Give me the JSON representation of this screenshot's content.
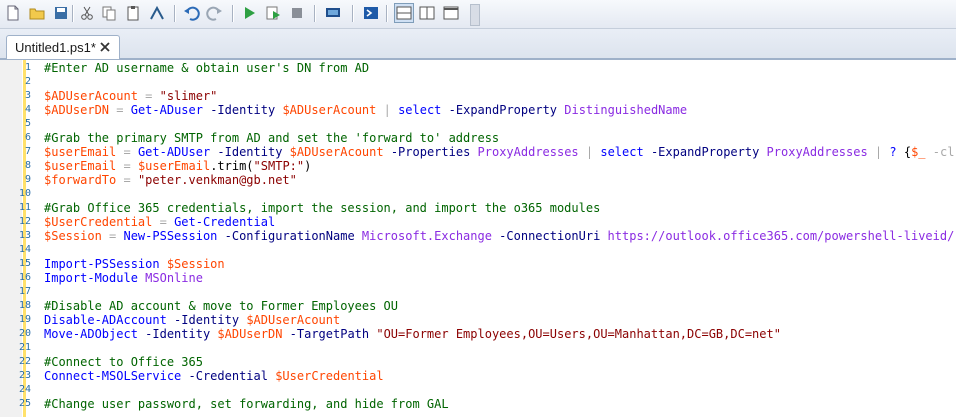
{
  "toolbar": {
    "buttons": [
      {
        "name": "new-file-icon"
      },
      {
        "name": "open-folder-icon"
      },
      {
        "name": "save-icon"
      },
      {
        "name": "cut-icon"
      },
      {
        "name": "copy-icon"
      },
      {
        "name": "paste-icon"
      },
      {
        "name": "clear-console-icon"
      },
      {
        "name": "undo-icon"
      },
      {
        "name": "redo-icon"
      },
      {
        "name": "run-script-icon"
      },
      {
        "name": "run-selection-icon"
      },
      {
        "name": "stop-icon"
      },
      {
        "name": "remote-powershell-icon"
      },
      {
        "name": "powershell-console-icon"
      },
      {
        "name": "layout-top-icon"
      },
      {
        "name": "layout-right-icon"
      },
      {
        "name": "layout-maximize-icon"
      }
    ]
  },
  "tab": {
    "label": "Untitled1.ps1*"
  },
  "editor": {
    "lines": [
      {
        "n": "1",
        "tokens": [
          [
            "c-com",
            "#Enter AD username & obtain user's DN from AD"
          ]
        ]
      },
      {
        "n": "2",
        "tokens": []
      },
      {
        "n": "3",
        "tokens": [
          [
            "c-var",
            "$ADUserAcount"
          ],
          [
            "c-op",
            " = "
          ],
          [
            "c-str",
            "\"slimer\""
          ]
        ]
      },
      {
        "n": "4",
        "tokens": [
          [
            "c-var",
            "$ADUserDN"
          ],
          [
            "c-op",
            " = "
          ],
          [
            "c-cmd",
            "Get-ADuser"
          ],
          [
            "c-par",
            " -Identity "
          ],
          [
            "c-var",
            "$ADUserAcount"
          ],
          [
            "c-op",
            " | "
          ],
          [
            "c-cmd",
            "select"
          ],
          [
            "c-par",
            " -ExpandProperty "
          ],
          [
            "c-arg",
            "DistinguishedName"
          ]
        ]
      },
      {
        "n": "5",
        "tokens": []
      },
      {
        "n": "6",
        "tokens": [
          [
            "c-com",
            "#Grab the primary SMTP from AD and set the 'forward to' address"
          ]
        ]
      },
      {
        "n": "7",
        "tokens": [
          [
            "c-var",
            "$userEmail"
          ],
          [
            "c-op",
            " = "
          ],
          [
            "c-cmd",
            "Get-ADUser"
          ],
          [
            "c-par",
            " -Identity "
          ],
          [
            "c-var",
            "$ADUserAcount"
          ],
          [
            "c-par",
            " -Properties "
          ],
          [
            "c-arg",
            "ProxyAddresses"
          ],
          [
            "c-op",
            " | "
          ],
          [
            "c-cmd",
            "select"
          ],
          [
            "c-par",
            " -ExpandProperty "
          ],
          [
            "c-arg",
            "ProxyAddresses"
          ],
          [
            "c-op",
            " | "
          ],
          [
            "c-cmd",
            "?"
          ],
          [
            "c-mem",
            " {"
          ],
          [
            "c-var",
            "$_"
          ],
          [
            "c-op",
            " -cl"
          ]
        ]
      },
      {
        "n": "8",
        "tokens": [
          [
            "c-var",
            "$userEmail"
          ],
          [
            "c-op",
            " = "
          ],
          [
            "c-var",
            "$userEmail"
          ],
          [
            "c-mem",
            ".trim("
          ],
          [
            "c-str",
            "\"SMTP:\""
          ],
          [
            "c-mem",
            ")"
          ]
        ]
      },
      {
        "n": "9",
        "tokens": [
          [
            "c-var",
            "$forwardTo"
          ],
          [
            "c-op",
            " = "
          ],
          [
            "c-str",
            "\"peter.venkman@gb.net\""
          ]
        ]
      },
      {
        "n": "10",
        "tokens": []
      },
      {
        "n": "11",
        "tokens": [
          [
            "c-com",
            "#Grab Office 365 credentials, import the session, and import the o365 modules"
          ]
        ]
      },
      {
        "n": "12",
        "tokens": [
          [
            "c-var",
            "$UserCredential"
          ],
          [
            "c-op",
            " = "
          ],
          [
            "c-cmd",
            "Get-Credential"
          ]
        ]
      },
      {
        "n": "13",
        "tokens": [
          [
            "c-var",
            "$Session"
          ],
          [
            "c-op",
            " = "
          ],
          [
            "c-cmd",
            "New-PSSession"
          ],
          [
            "c-par",
            " -ConfigurationName "
          ],
          [
            "c-arg",
            "Microsoft.Exchange"
          ],
          [
            "c-par",
            " -ConnectionUri "
          ],
          [
            "c-arg",
            "https://outlook.office365.com/powershell-liveid/"
          ]
        ]
      },
      {
        "n": "14",
        "tokens": []
      },
      {
        "n": "15",
        "tokens": [
          [
            "c-cmd",
            "Import-PSSession"
          ],
          [
            "c-mem",
            " "
          ],
          [
            "c-var",
            "$Session"
          ]
        ]
      },
      {
        "n": "16",
        "tokens": [
          [
            "c-cmd",
            "Import-Module"
          ],
          [
            "c-mem",
            " "
          ],
          [
            "c-arg",
            "MSOnline"
          ]
        ]
      },
      {
        "n": "17",
        "tokens": []
      },
      {
        "n": "18",
        "tokens": [
          [
            "c-com",
            "#Disable AD account & move to Former Employees OU"
          ]
        ]
      },
      {
        "n": "19",
        "tokens": [
          [
            "c-cmd",
            "Disable-ADAccount"
          ],
          [
            "c-par",
            " -Identity "
          ],
          [
            "c-var",
            "$ADUserAcount"
          ]
        ]
      },
      {
        "n": "20",
        "tokens": [
          [
            "c-cmd",
            "Move-ADObject"
          ],
          [
            "c-par",
            " -Identity "
          ],
          [
            "c-var",
            "$ADUserDN"
          ],
          [
            "c-par",
            " -TargetPath "
          ],
          [
            "c-str",
            "\"OU=Former Employees,OU=Users,OU=Manhattan,DC=GB,DC=net\""
          ]
        ]
      },
      {
        "n": "21",
        "tokens": []
      },
      {
        "n": "22",
        "tokens": [
          [
            "c-com",
            "#Connect to Office 365"
          ]
        ]
      },
      {
        "n": "23",
        "tokens": [
          [
            "c-cmd",
            "Connect-MSOLService"
          ],
          [
            "c-par",
            " -Credential "
          ],
          [
            "c-var",
            "$UserCredential"
          ]
        ]
      },
      {
        "n": "24",
        "tokens": []
      },
      {
        "n": "25",
        "tokens": [
          [
            "c-com",
            "#Change user password, set forwarding, and hide from GAL"
          ]
        ]
      }
    ]
  }
}
